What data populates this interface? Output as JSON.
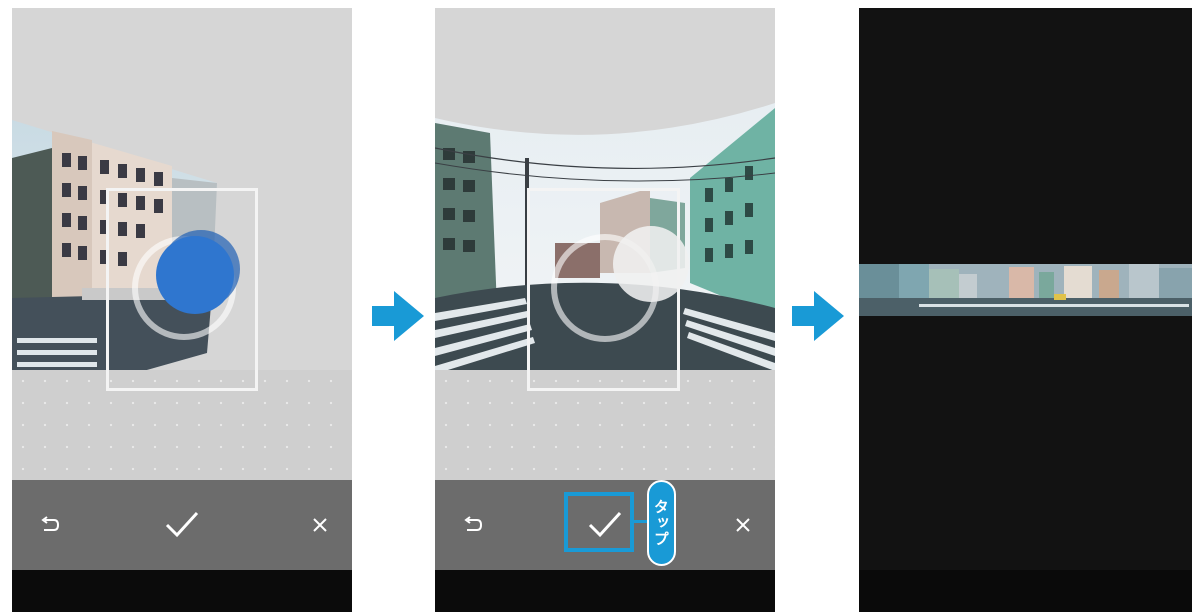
{
  "screens": [
    {
      "id": "panorama-capturing",
      "toolbar": {
        "undo_icon": "undo-icon",
        "confirm_icon": "check-icon",
        "cancel_icon": "close-icon"
      }
    },
    {
      "id": "panorama-confirm",
      "toolbar": {
        "undo_icon": "undo-icon",
        "confirm_icon": "check-icon",
        "cancel_icon": "close-icon"
      },
      "callout": {
        "label": "タップ",
        "color": "#199ad6"
      }
    },
    {
      "id": "panorama-saved",
      "background": "#121212"
    }
  ],
  "flow_arrow_color": "#199ad6",
  "target_color": "#2f76cf",
  "toolbar_color": "#6c6c6c"
}
